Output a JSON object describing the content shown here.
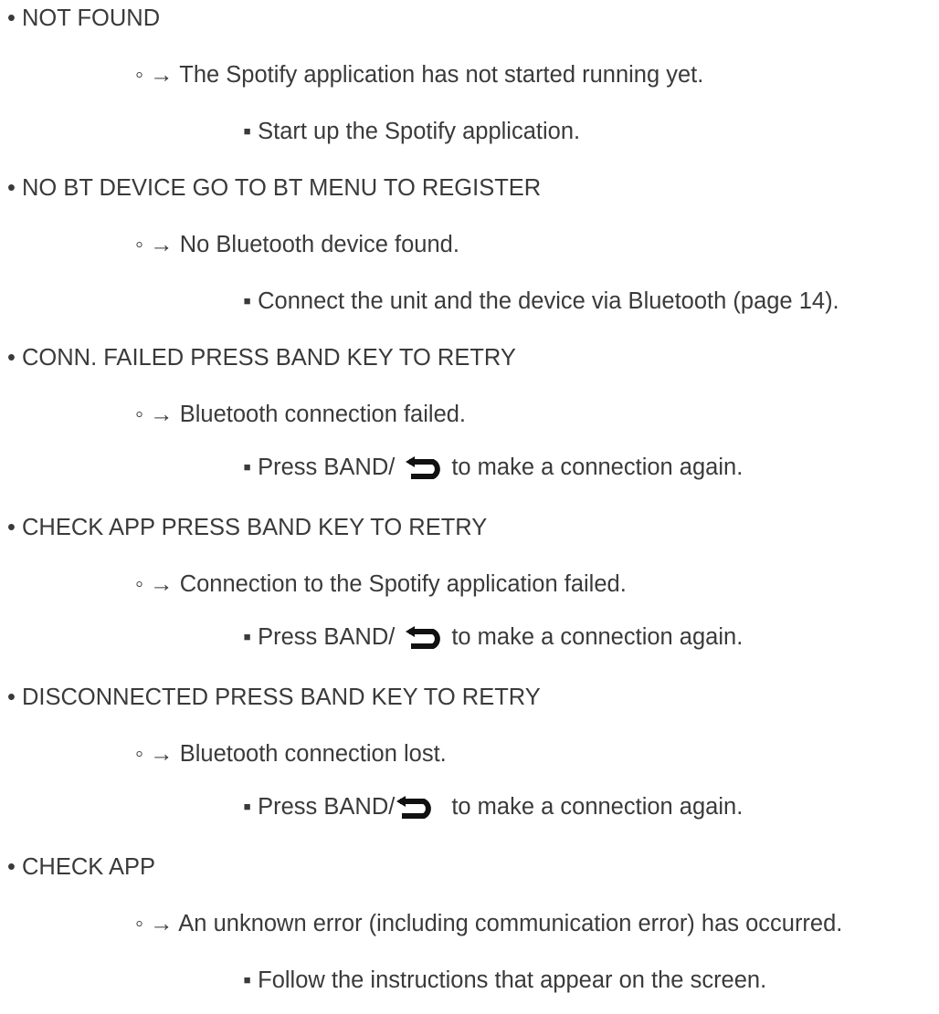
{
  "messages": [
    {
      "code": "• NOT FOUND",
      "cause": "◦ → The Spotify application has not started running yet.",
      "action": "▪ Start up the Spotify application."
    },
    {
      "code": "• NO BT DEVICE GO TO BT MENU TO REGISTER",
      "cause": "◦ → No Bluetooth device found.",
      "action": "▪ Connect the unit and the device via Bluetooth (page 14)."
    },
    {
      "code": "• CONN. FAILED PRESS BAND KEY TO RETRY",
      "cause": "◦ → Bluetooth connection failed.",
      "action_prefix": "▪ Press BAND/",
      "action_icon": "back-icon",
      "action_suffix": "to make a connection again."
    },
    {
      "code": "• CHECK APP PRESS BAND KEY TO RETRY",
      "cause": "◦ → Connection to the Spotify application failed.",
      "action_prefix": "▪ Press BAND/",
      "action_icon": "back-icon",
      "action_suffix": "to make a connection again."
    },
    {
      "code": "• DISCONNECTED PRESS BAND KEY TO RETRY",
      "cause": "◦ → Bluetooth connection lost.",
      "action_prefix": "▪ Press BAND/",
      "action_icon": "back-icon",
      "action_suffix": "to make a connection again."
    },
    {
      "code": "• CHECK APP",
      "cause": "◦ → An unknown error (including communication error) has occurred.",
      "action": "▪ Follow the instructions that appear on the screen."
    }
  ]
}
